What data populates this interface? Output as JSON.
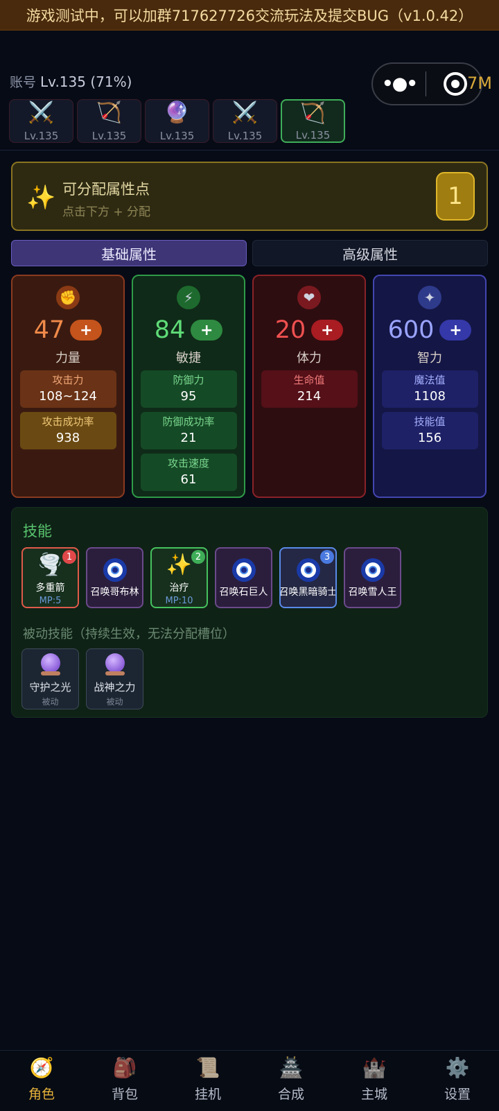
{
  "banner": {
    "text": "游戏测试中，可以加群717627726交流玩法及提交BUG（v1.0.42）"
  },
  "account": {
    "label": "账号",
    "level": "Lv.135 (71%)"
  },
  "capsule": {
    "gold_value": "7M"
  },
  "heroes": [
    {
      "icon": "crossed-swords-icon",
      "glyph": "⚔️",
      "level": "Lv.135",
      "selected": false
    },
    {
      "icon": "bow-icon",
      "glyph": "🏹",
      "level": "Lv.135",
      "selected": false
    },
    {
      "icon": "crystal-ball-icon",
      "glyph": "🔮",
      "level": "Lv.135",
      "selected": false
    },
    {
      "icon": "crossed-swords-icon",
      "glyph": "⚔️",
      "level": "Lv.135",
      "selected": false
    },
    {
      "icon": "bow-icon",
      "glyph": "🏹",
      "level": "Lv.135",
      "selected": true
    }
  ],
  "points": {
    "title": "可分配属性点",
    "subtitle": "点击下方 + 分配",
    "value": "1"
  },
  "tabs": {
    "basic": "基础属性",
    "advanced": "高级属性"
  },
  "stats": {
    "str": {
      "value": "47",
      "plus": "+",
      "name": "力量",
      "boxes": [
        {
          "label": "攻击力",
          "value": "108~124"
        },
        {
          "label": "攻击成功率",
          "value": "938"
        }
      ]
    },
    "agi": {
      "value": "84",
      "plus": "+",
      "name": "敏捷",
      "boxes": [
        {
          "label": "防御力",
          "value": "95"
        },
        {
          "label": "防御成功率",
          "value": "21"
        },
        {
          "label": "攻击速度",
          "value": "61"
        }
      ]
    },
    "vit": {
      "value": "20",
      "plus": "+",
      "name": "体力",
      "boxes": [
        {
          "label": "生命值",
          "value": "214"
        }
      ]
    },
    "int": {
      "value": "600",
      "plus": "+",
      "name": "智力",
      "boxes": [
        {
          "label": "魔法值",
          "value": "1108"
        },
        {
          "label": "技能值",
          "value": "156"
        }
      ]
    }
  },
  "skills": {
    "title": "技能",
    "active": [
      {
        "name": "多重箭",
        "mp": "MP:5",
        "slot": "1"
      },
      {
        "name": "召唤哥布林"
      },
      {
        "name": "治疗",
        "mp": "MP:10",
        "slot": "2"
      },
      {
        "name": "召唤石巨人"
      },
      {
        "name": "召唤黑暗骑士",
        "slot": "3"
      },
      {
        "name": "召唤雪人王"
      }
    ],
    "passive_title": "被动技能（持续生效，无法分配槽位）",
    "passive": [
      {
        "name": "守护之光",
        "tag": "被动"
      },
      {
        "name": "战神之力",
        "tag": "被动"
      }
    ]
  },
  "nav": [
    {
      "label": "角色",
      "icon": "character-icon",
      "active": true
    },
    {
      "label": "背包",
      "icon": "backpack-icon"
    },
    {
      "label": "挂机",
      "icon": "scroll-icon"
    },
    {
      "label": "合成",
      "icon": "forge-icon"
    },
    {
      "label": "主城",
      "icon": "castle-icon"
    },
    {
      "label": "设置",
      "icon": "gear-icon"
    }
  ]
}
